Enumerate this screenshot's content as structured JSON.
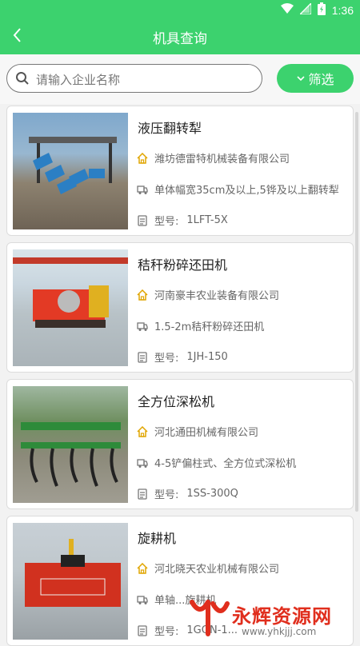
{
  "status": {
    "time": "1:36"
  },
  "header": {
    "title": "机具查询"
  },
  "search": {
    "placeholder": "请输入企业名称",
    "filter_label": "筛选"
  },
  "items": [
    {
      "title": "液压翻转犁",
      "company": "潍坊德雷特机械装备有限公司",
      "desc": "单体幅宽35cm及以上,5铧及以上翻转犁",
      "model_label": "型号:",
      "model": "1LFT-5X"
    },
    {
      "title": "秸秆粉碎还田机",
      "company": "河南豪丰农业装备有限公司",
      "desc": "1.5-2m秸秆粉碎还田机",
      "model_label": "型号:",
      "model": "1JH-150"
    },
    {
      "title": "全方位深松机",
      "company": "河北通田机械有限公司",
      "desc": "4-5铲偏柱式、全方位式深松机",
      "model_label": "型号:",
      "model": "1SS-300Q"
    },
    {
      "title": "旋耕机",
      "company": "河北晓天农业机械有限公司",
      "desc": "单轴...旋耕机",
      "model_label": "型号:",
      "model": "1GQN-1..."
    }
  ],
  "watermark": {
    "name": "永辉资源网",
    "url": "www.yhkjjj.com"
  },
  "colors": {
    "accent": "#3cd26e",
    "house_icon": "#e0a500",
    "watermark": "#e02e1d"
  }
}
